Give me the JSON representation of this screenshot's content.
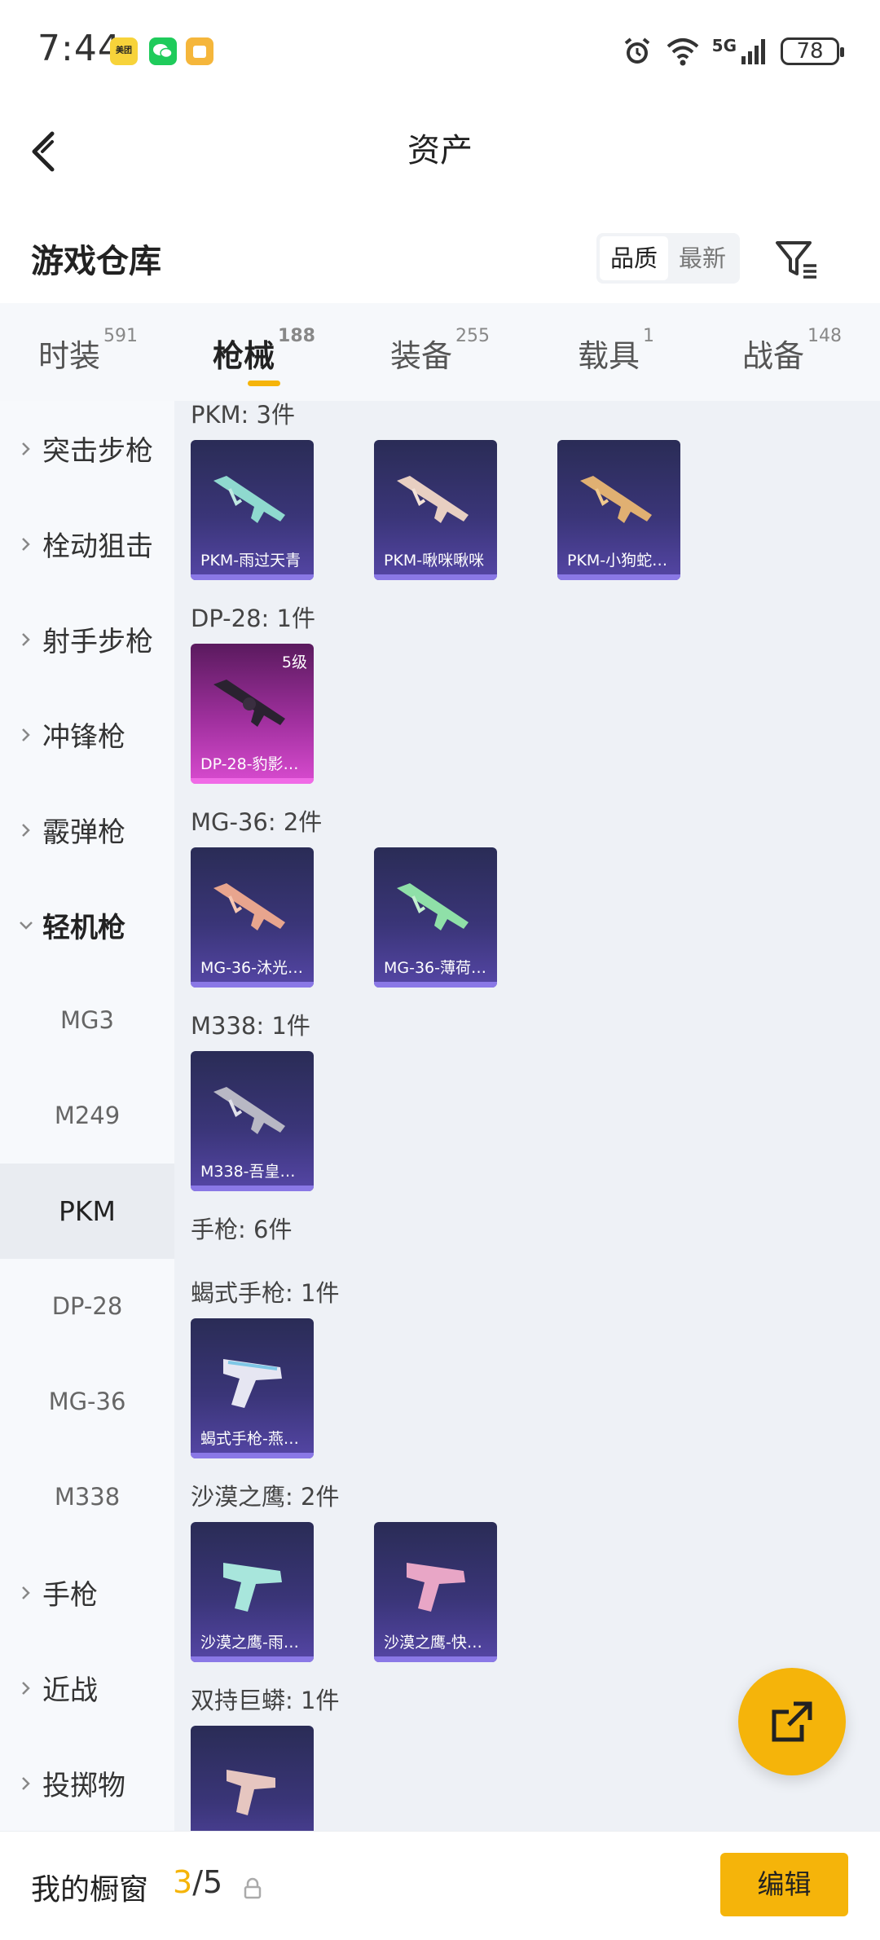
{
  "status_bar": {
    "time": "7:44",
    "apps": [
      "美团",
      "微信",
      "其他"
    ],
    "network": "5G",
    "battery": "78"
  },
  "header": {
    "title": "资产"
  },
  "warehouse": {
    "title": "游戏仓库",
    "sort_options": [
      "品质",
      "最新"
    ],
    "active_sort": "品质"
  },
  "tabs": [
    {
      "label": "时装",
      "count": "591"
    },
    {
      "label": "枪械",
      "count": "188",
      "active": true
    },
    {
      "label": "装备",
      "count": "255"
    },
    {
      "label": "载具",
      "count": "1"
    },
    {
      "label": "战备",
      "count": "148"
    }
  ],
  "sidebar": {
    "categories": [
      {
        "label": "突击步枪"
      },
      {
        "label": "栓动狙击"
      },
      {
        "label": "射手步枪"
      },
      {
        "label": "冲锋枪"
      },
      {
        "label": "霰弹枪"
      },
      {
        "label": "轻机枪",
        "expanded": true
      }
    ],
    "subitems": [
      {
        "label": "MG3"
      },
      {
        "label": "M249"
      },
      {
        "label": "PKM",
        "active": true
      },
      {
        "label": "DP-28"
      },
      {
        "label": "MG-36"
      },
      {
        "label": "M338"
      }
    ],
    "more_categories": [
      {
        "label": "手枪"
      },
      {
        "label": "近战"
      },
      {
        "label": "投掷物"
      }
    ]
  },
  "content": {
    "groups": [
      {
        "label": "PKM: 3件"
      },
      {
        "label": "DP-28: 1件"
      },
      {
        "label": "MG-36: 2件"
      },
      {
        "label": "M338: 1件"
      },
      {
        "label": "手枪: 6件"
      },
      {
        "label": "蝎式手枪: 1件"
      },
      {
        "label": "沙漠之鹰: 2件"
      },
      {
        "label": "双持巨蟒: 1件"
      }
    ],
    "cards": [
      {
        "name": "PKM-雨过天青",
        "quality": "purple"
      },
      {
        "name": "PKM-啾咪啾咪",
        "quality": "purple"
      },
      {
        "name": "PKM-小狗蛇…",
        "quality": "purple"
      },
      {
        "name": "DP-28-豹影…",
        "quality": "pink",
        "level": "5级"
      },
      {
        "name": "MG-36-沐光…",
        "quality": "purple"
      },
      {
        "name": "MG-36-薄荷…",
        "quality": "purple"
      },
      {
        "name": "M338-吾皇…",
        "quality": "purple"
      },
      {
        "name": "蝎式手枪-燕…",
        "quality": "purple"
      },
      {
        "name": "沙漠之鹰-雨…",
        "quality": "purple"
      },
      {
        "name": "沙漠之鹰-快…",
        "quality": "purple"
      },
      {
        "name": "",
        "quality": "purple"
      }
    ]
  },
  "bottom_bar": {
    "label": "我的橱窗",
    "count_current": "3",
    "count_total": "/5",
    "edit_label": "编辑"
  },
  "colors": {
    "accent": "#f5b40a",
    "card_purple": "#3a3578",
    "card_pink": "#a0309e"
  }
}
